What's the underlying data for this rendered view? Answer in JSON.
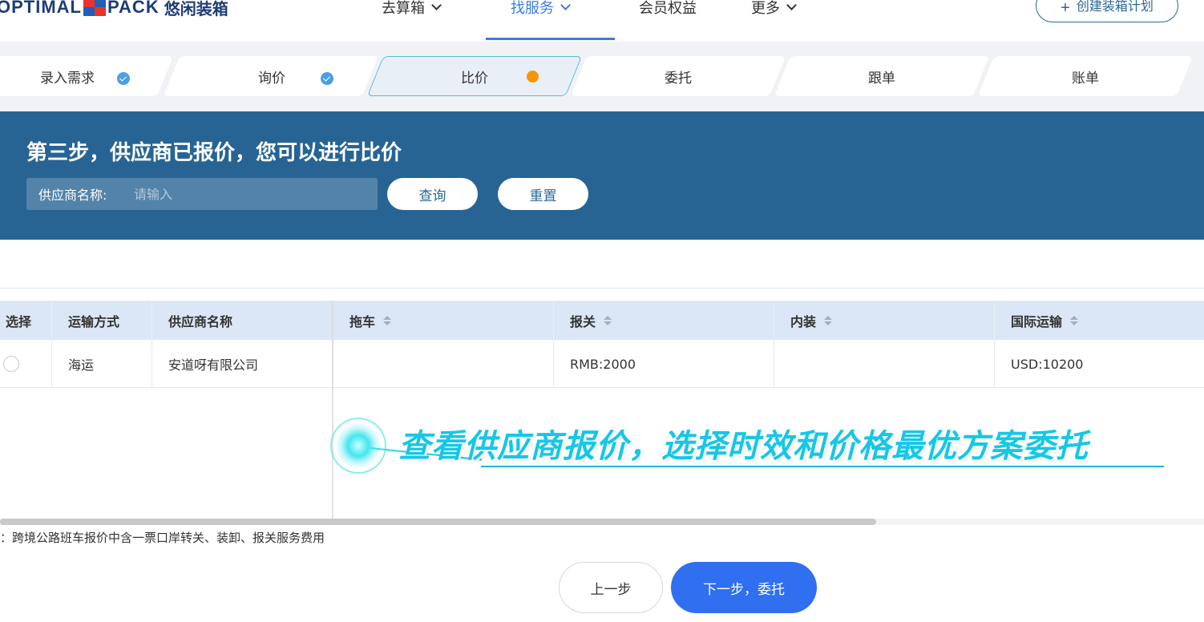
{
  "nav": {
    "logo_text_left": "OPTIMAL",
    "logo_text_right": "PACK",
    "logo_text_cn": "悠闲装箱",
    "items": [
      {
        "label": "去算箱",
        "has_dropdown": true
      },
      {
        "label": "找服务",
        "has_dropdown": true,
        "active": true
      },
      {
        "label": "会员权益",
        "has_dropdown": false
      },
      {
        "label": "更多",
        "has_dropdown": true
      }
    ],
    "create_button": "创建装箱计划",
    "accent_color": "#3b7be0"
  },
  "steps": [
    {
      "label": "录入需求",
      "status": "done"
    },
    {
      "label": "询价",
      "status": "done"
    },
    {
      "label": "比价",
      "status": "current"
    },
    {
      "label": "委托",
      "status": "todo"
    },
    {
      "label": "跟单",
      "status": "todo"
    },
    {
      "label": "账单",
      "status": "todo"
    }
  ],
  "hero": {
    "title": "第三步，供应商已报价，您可以进行比价",
    "search_label": "供应商名称:",
    "search_placeholder": "请输入",
    "search_value": "",
    "query_button": "查询",
    "reset_button": "重置",
    "bg_color": "#276494"
  },
  "table": {
    "columns": [
      "选择",
      "运输方式",
      "供应商名称",
      "拖车",
      "报关",
      "内装",
      "国际运输"
    ],
    "sortable": [
      false,
      false,
      false,
      true,
      true,
      true,
      true
    ],
    "rows": [
      {
        "select": "",
        "transport": "海运",
        "supplier": "安道呀有限公司",
        "trailer": "",
        "customs": "RMB:2000",
        "packing": "",
        "intl": "USD:10200"
      }
    ]
  },
  "note": "：跨境公路班车报价中含一票口岸转关、装卸、报关服务费用",
  "overlay_banner": "查看供应商报价，选择时效和价格最优方案委托",
  "footer": {
    "prev_button": "上一步",
    "next_button": "下一步，委托",
    "primary_color": "#2f6ff0"
  }
}
